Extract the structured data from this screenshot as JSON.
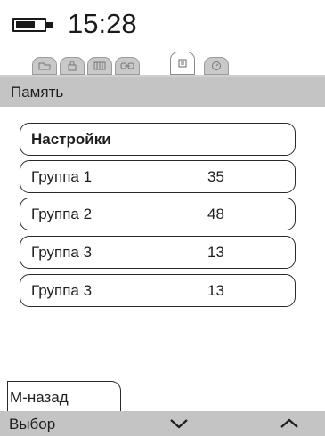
{
  "status_bar": {
    "time": "15:28",
    "battery_level": 0.7
  },
  "tabs": [
    {
      "icon": "folder-icon",
      "active": false
    },
    {
      "icon": "lock-icon",
      "active": false
    },
    {
      "icon": "keypad-icon",
      "active": false
    },
    {
      "icon": "link-icon",
      "active": false
    },
    {
      "icon": "memory-icon",
      "active": true
    },
    {
      "icon": "gauge-icon",
      "active": false
    }
  ],
  "header": {
    "title": "Память"
  },
  "menu": {
    "settings_label": "Настройки",
    "groups": [
      {
        "label": "Группа 1",
        "value": "35"
      },
      {
        "label": "Группа 2",
        "value": "48"
      },
      {
        "label": "Группа 3",
        "value": "13"
      },
      {
        "label": "Группа 3",
        "value": "13"
      }
    ]
  },
  "back_tab": {
    "label": "М-назад"
  },
  "softkeys": {
    "left_label": "Выбор",
    "center_icon": "chevron-down-icon",
    "right_icon": "chevron-up-icon"
  },
  "colors": {
    "bar_gray": "#c4c4c4",
    "border": "#2a2a2a"
  }
}
